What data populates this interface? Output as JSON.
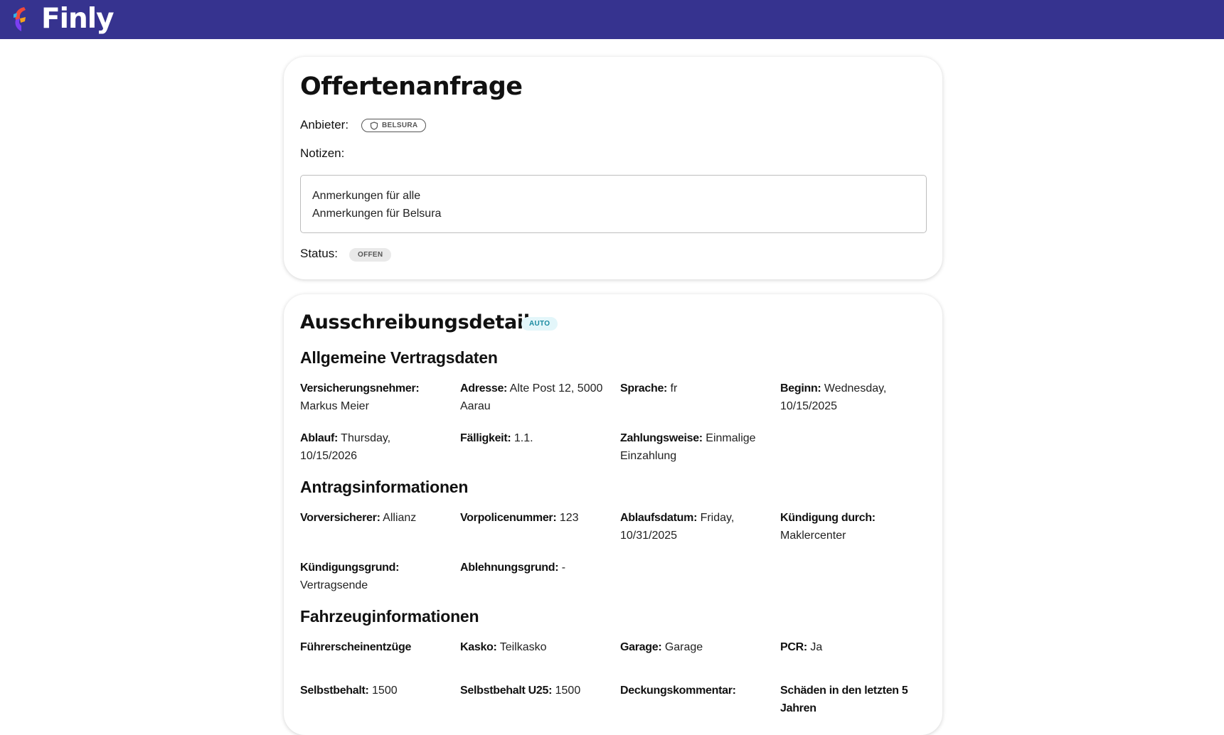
{
  "app": {
    "name": "Finly"
  },
  "request": {
    "title": "Offertenanfrage",
    "provider_label": "Anbieter:",
    "provider_chip": "BELSURA",
    "notes_label": "Notizen:",
    "notes_lines": [
      "Anmerkungen für alle",
      "Anmerkungen für Belsura"
    ],
    "status_label": "Status:",
    "status_chip": "OFFEN"
  },
  "details": {
    "title": "Ausschreibungsdetails",
    "type_chip": "AUTO",
    "sections": [
      {
        "title": "Allgemeine Vertragsdaten",
        "fields": [
          {
            "label": "Versicherungsnehmer:",
            "value": "Markus Meier"
          },
          {
            "label": "Adresse:",
            "value": "Alte Post 12, 5000 Aarau"
          },
          {
            "label": "Sprache:",
            "value": "fr"
          },
          {
            "label": "Beginn:",
            "value": "Wednesday, 10/15/2025"
          },
          {
            "label": "Ablauf:",
            "value": "Thursday, 10/15/2026"
          },
          {
            "label": "Fälligkeit:",
            "value": "1.1."
          },
          {
            "label": "Zahlungsweise:",
            "value": "Einmalige Einzahlung"
          }
        ]
      },
      {
        "title": "Antragsinformationen",
        "fields": [
          {
            "label": "Vorversicherer:",
            "value": "Allianz"
          },
          {
            "label": "Vorpolicenummer:",
            "value": "123"
          },
          {
            "label": "Ablaufsdatum:",
            "value": "Friday, 10/31/2025"
          },
          {
            "label": "Kündigung durch:",
            "value": "Maklercenter"
          },
          {
            "label": "Kündigungsgrund:",
            "value": "Vertragsende"
          },
          {
            "label": "Ablehnungsgrund:",
            "value": "-"
          }
        ]
      },
      {
        "title": "Fahrzeuginformationen",
        "fields": [
          {
            "label": "Führerscheinentzüge",
            "value": ""
          },
          {
            "label": "Kasko:",
            "value": "Teilkasko"
          },
          {
            "label": "Garage:",
            "value": "Garage"
          },
          {
            "label": "PCR:",
            "value": "Ja"
          },
          {
            "label": "Selbstbehalt:",
            "value": "1500"
          },
          {
            "label": "Selbstbehalt U25:",
            "value": "1500"
          },
          {
            "label": "Deckungskommentar:",
            "value": ""
          },
          {
            "label": "Schäden in den letzten 5 Jahren",
            "value": ""
          }
        ]
      }
    ]
  }
}
